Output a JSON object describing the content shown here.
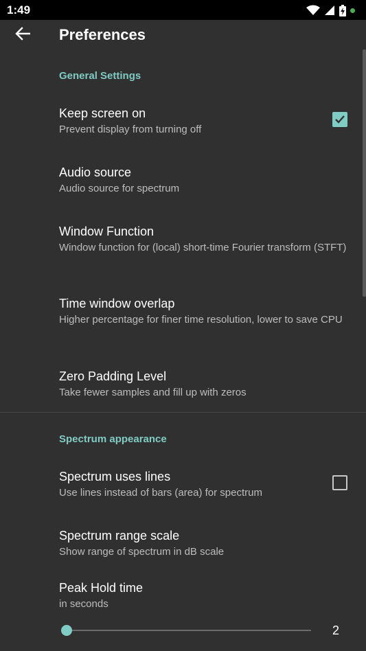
{
  "status_bar": {
    "time": "1:49",
    "icons": [
      "wifi-icon",
      "signal-icon",
      "battery-charging-icon",
      "notification-dot-icon"
    ]
  },
  "app_bar": {
    "title": "Preferences",
    "back_icon": "arrow-back-icon"
  },
  "accent_color": "#80cbc4",
  "sections": {
    "general": {
      "header": "General Settings",
      "keep_screen_on": {
        "title": "Keep screen on",
        "summary": "Prevent display from turning off",
        "checked": true
      },
      "audio_source": {
        "title": "Audio source",
        "summary": "Audio source for spectrum"
      },
      "window_function": {
        "title": "Window Function",
        "summary": "Window function for (local) short-time Fourier transform (STFT)"
      },
      "time_window_overlap": {
        "title": "Time window overlap",
        "summary": "Higher percentage for finer time resolution, lower to save CPU"
      },
      "zero_padding": {
        "title": "Zero Padding Level",
        "summary": "Take fewer samples and fill up with zeros"
      }
    },
    "spectrum": {
      "header": "Spectrum appearance",
      "uses_lines": {
        "title": "Spectrum uses lines",
        "summary": "Use lines instead of bars (area) for spectrum",
        "checked": false
      },
      "range_scale": {
        "title": "Spectrum range scale",
        "summary": "Show range of spectrum in dB scale"
      },
      "peak_hold": {
        "title": "Peak Hold time",
        "summary": "in seconds",
        "value": "2",
        "fraction": 0.0
      }
    }
  }
}
